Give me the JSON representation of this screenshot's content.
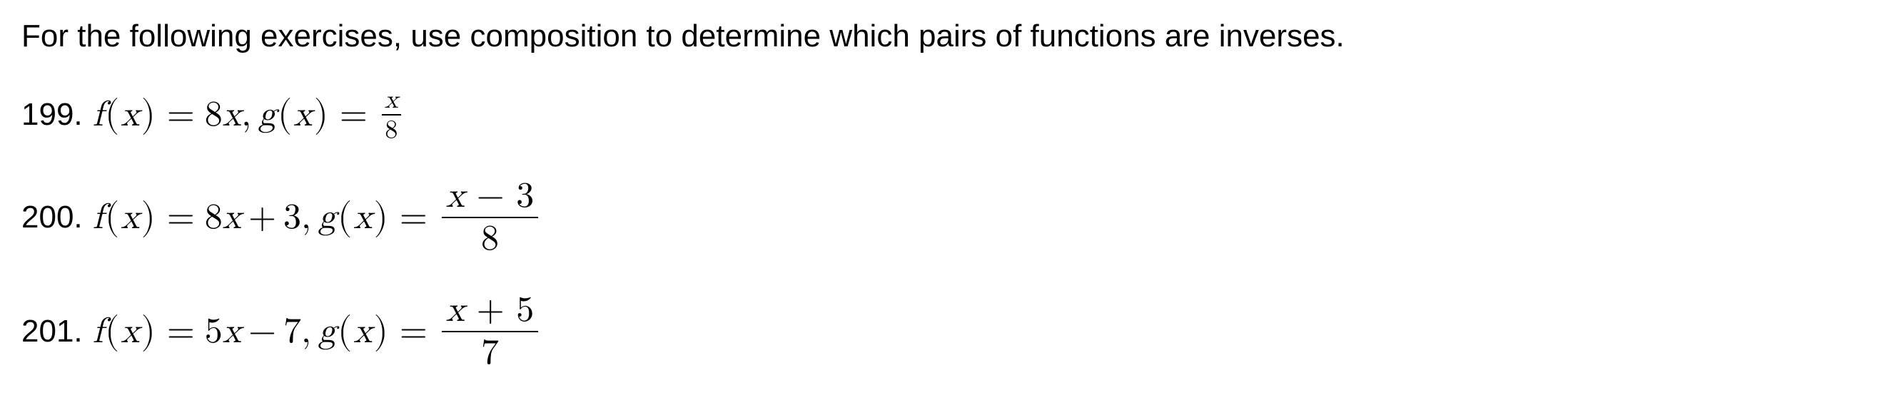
{
  "instructions": "For the following exercises, use composition to determine which pairs of functions are inverses.",
  "exercises": [
    {
      "number": "199.",
      "f_lhs_var": "f",
      "f_arg": "x",
      "f_rhs_coef": "8",
      "f_rhs_var": "x",
      "g_lhs_var": "g",
      "g_arg": "x",
      "g_frac_num": "x",
      "g_frac_den": "8",
      "small_frac": true
    },
    {
      "number": "200.",
      "f_lhs_var": "f",
      "f_arg": "x",
      "f_rhs_coef": "8",
      "f_rhs_var": "x",
      "f_rhs_op": "+",
      "f_rhs_const": "3",
      "g_lhs_var": "g",
      "g_arg": "x",
      "g_frac_num_var": "x",
      "g_frac_num_op": "−",
      "g_frac_num_const": "3",
      "g_frac_den": "8",
      "small_frac": false
    },
    {
      "number": "201.",
      "f_lhs_var": "f",
      "f_arg": "x",
      "f_rhs_coef": "5",
      "f_rhs_var": "x",
      "f_rhs_op": "−",
      "f_rhs_const": "7",
      "g_lhs_var": "g",
      "g_arg": "x",
      "g_frac_num_var": "x",
      "g_frac_num_op": "+",
      "g_frac_num_const": "5",
      "g_frac_den": "7",
      "small_frac": false
    }
  ]
}
